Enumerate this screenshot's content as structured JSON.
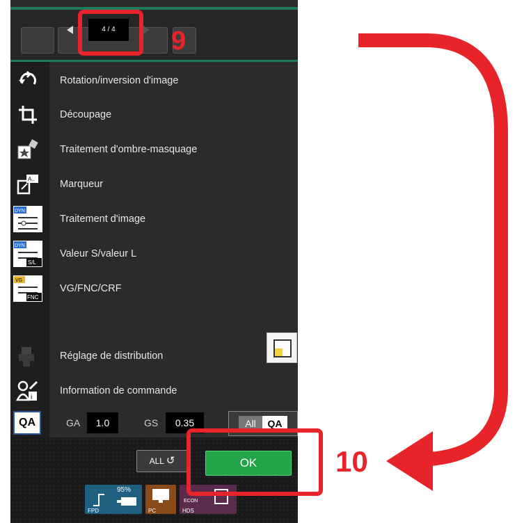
{
  "nav": {
    "page_indicator": "4 / 4"
  },
  "callouts": {
    "step_a": "9",
    "step_b": "10"
  },
  "menu": [
    {
      "label": "Rotation/inversion d'image",
      "icon": "rotate-icon"
    },
    {
      "label": "Découpage",
      "icon": "crop-icon"
    },
    {
      "label": "Traitement d'ombre-masquage",
      "icon": "shadow-mask-icon"
    },
    {
      "label": "Marqueur",
      "icon": "marker-icon"
    },
    {
      "label": "Traitement d'image",
      "icon": "dyn-image-processing-icon",
      "tag": "DYN"
    },
    {
      "label": "Valeur S/valeur L",
      "icon": "dyn-sl-icon",
      "tag": "DYN",
      "subtag": "S/L"
    },
    {
      "label": "VG/FNC/CRF",
      "icon": "vg-fnc-icon",
      "tag": "VG",
      "subtag": "FNC"
    },
    {
      "label": "Réglage de distribution",
      "icon": "distribution-icon"
    },
    {
      "label": "Information de commande",
      "icon": "order-info-icon"
    }
  ],
  "qa": {
    "icon_label": "QA",
    "ga_label": "GA",
    "ga_value": "1.0",
    "gs_label": "GS",
    "gs_value": "0.35",
    "all_label": "All",
    "qa_label": "QA"
  },
  "actions": {
    "all_undo_label": "ALL",
    "ok_label": "OK"
  },
  "status": {
    "fpd": {
      "label": "FPD",
      "percent": "95%"
    },
    "pc": {
      "label": "PC"
    },
    "hds": {
      "label": "HDS",
      "tag": "ECON"
    }
  },
  "colors": {
    "accent_red": "#e8242b",
    "ok_green": "#21a44a",
    "teal_line": "#1f7a5a"
  }
}
